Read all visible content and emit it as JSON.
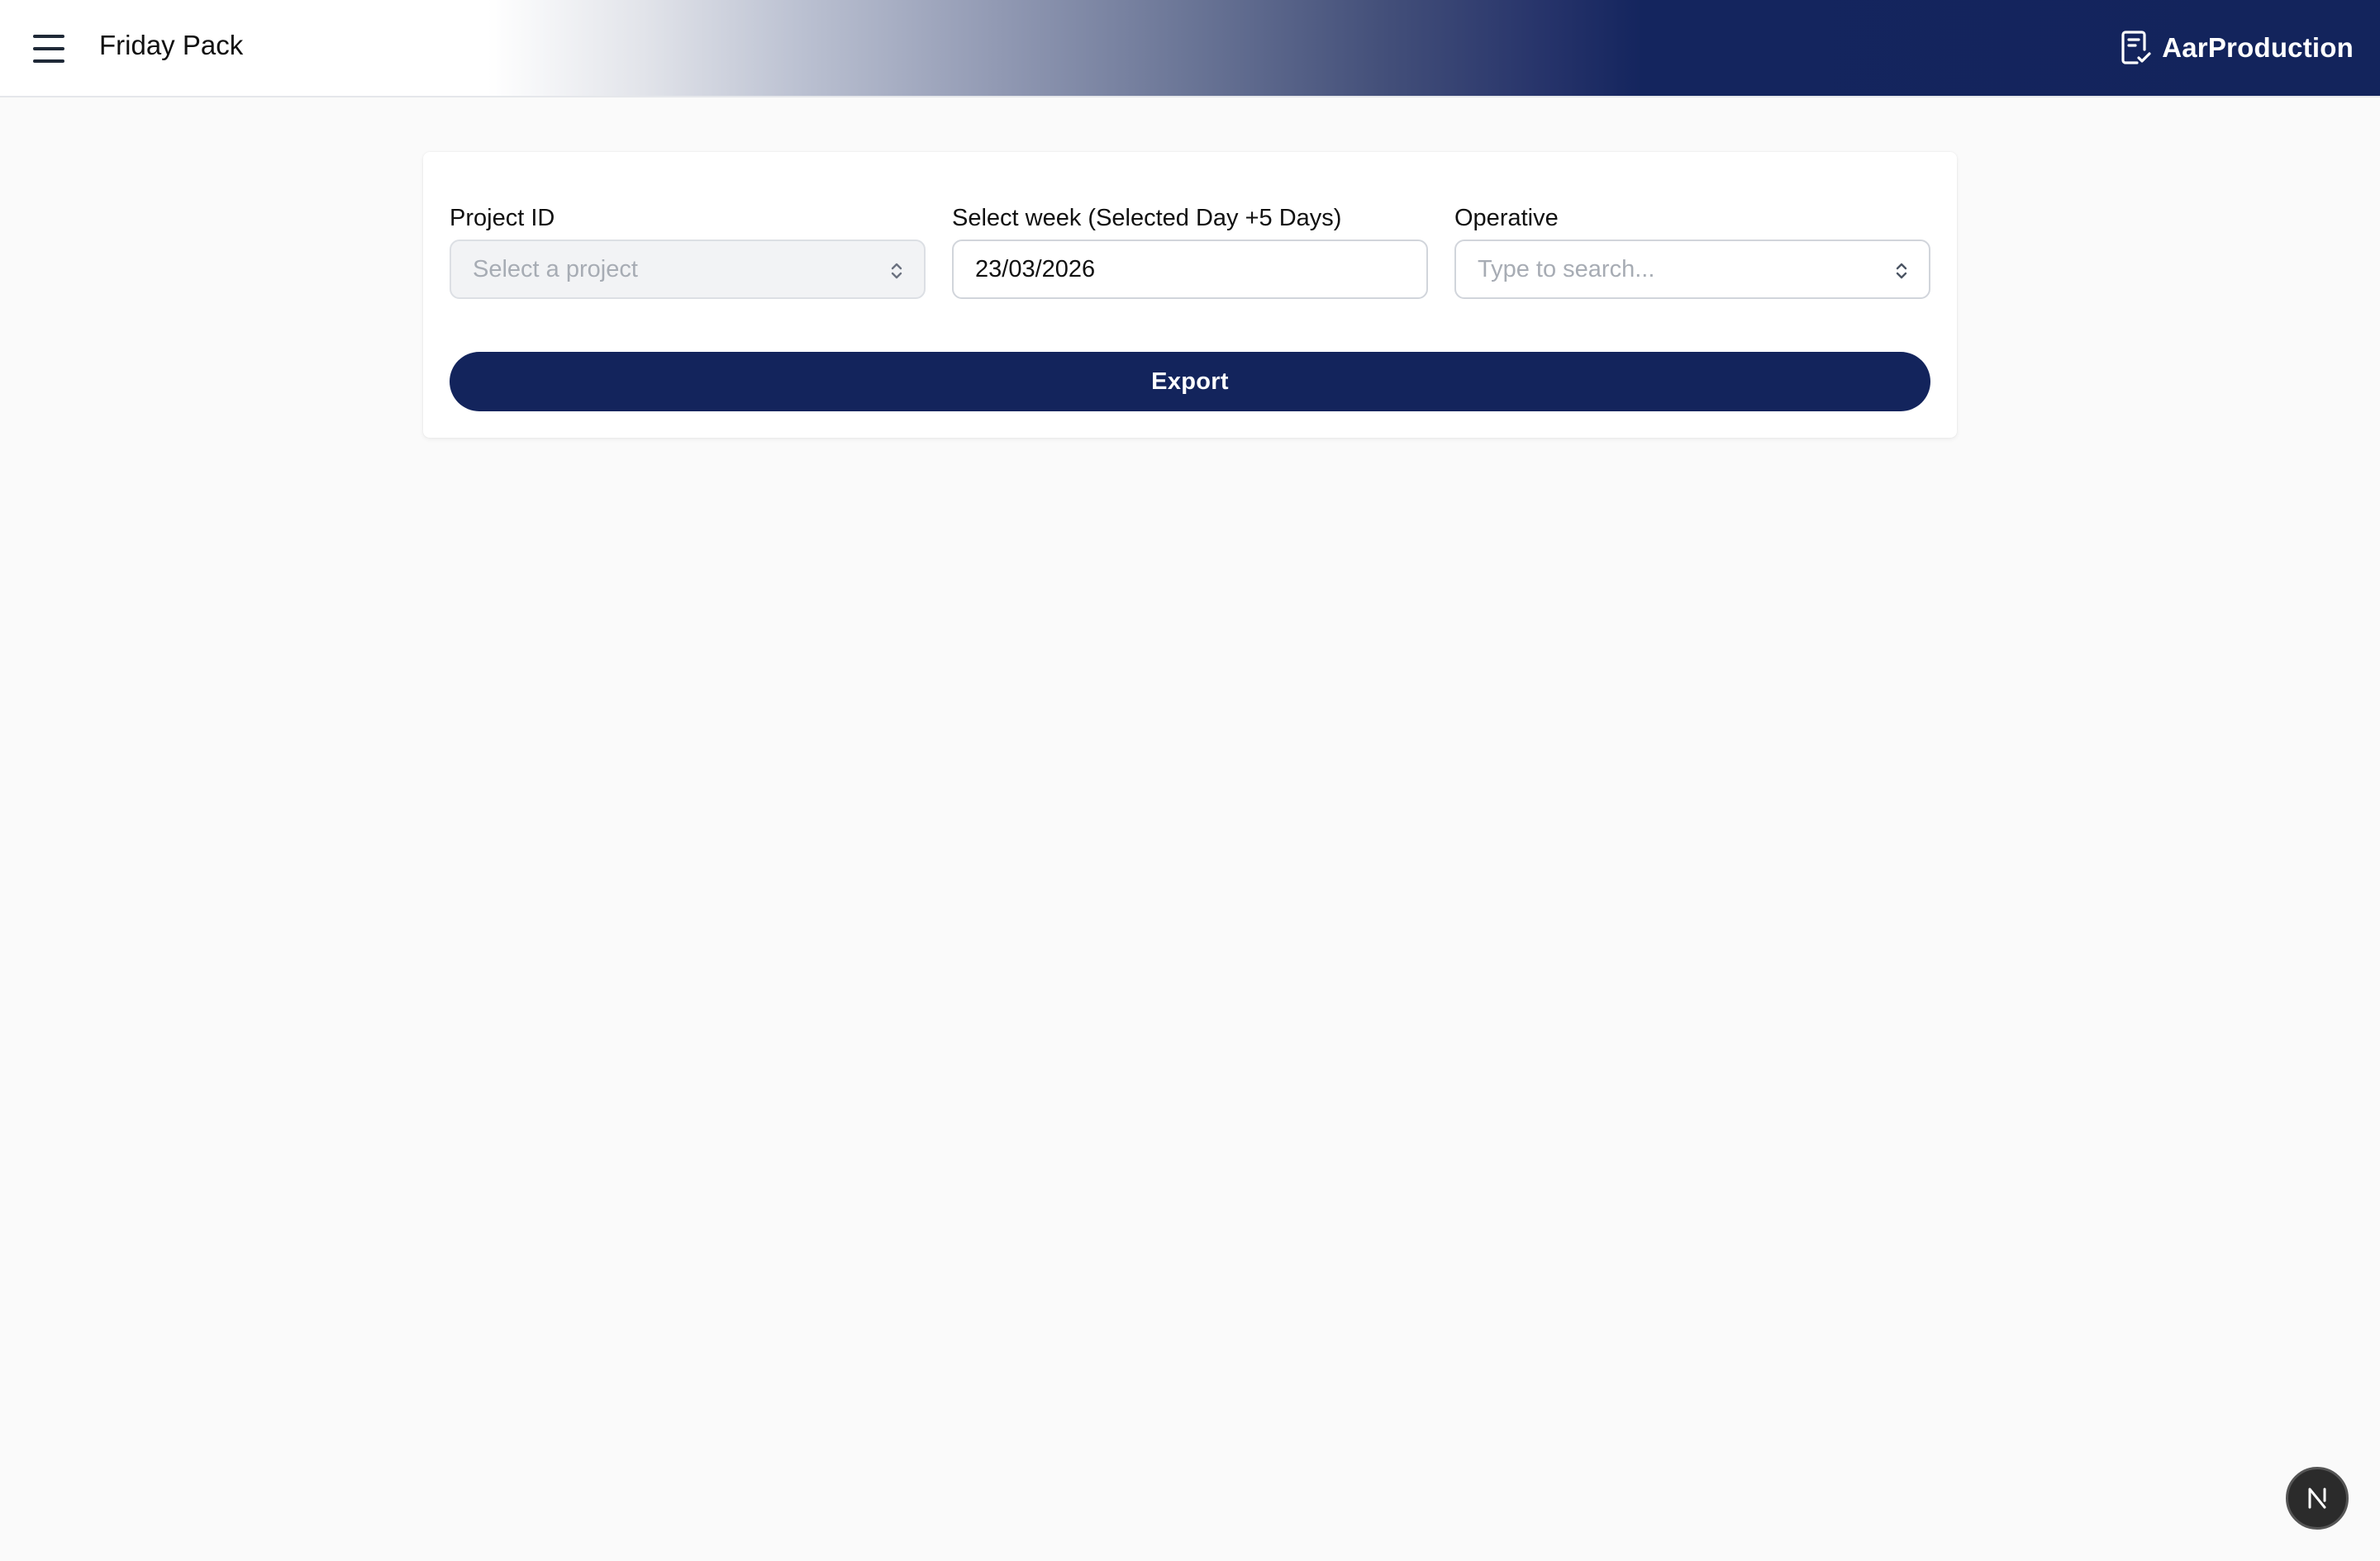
{
  "header": {
    "title": "Friday Pack",
    "brand_name": "AarProduction",
    "menu_icon": "hamburger-menu-icon",
    "brand_icon": "clipboard-check-icon"
  },
  "form": {
    "project": {
      "label": "Project ID",
      "placeholder": "Select a project",
      "disabled": true
    },
    "week": {
      "label": "Select week (Selected Day +5 Days)",
      "value": "23/03/2026"
    },
    "operative": {
      "label": "Operative",
      "placeholder": "Type to search..."
    },
    "export_label": "Export"
  },
  "colors": {
    "brand_navy": "#13245c",
    "background": "#fafafa",
    "card": "#ffffff"
  },
  "floating_badge": {
    "icon": "n-logo-icon"
  }
}
